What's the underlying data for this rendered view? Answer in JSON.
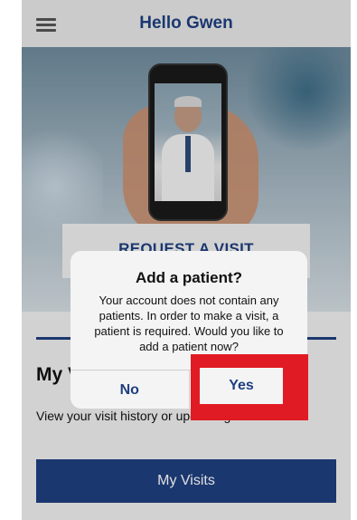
{
  "header": {
    "title": "Hello Gwen",
    "menu_icon": "hamburger-menu-icon"
  },
  "hero": {
    "request_label": "REQUEST A VISIT"
  },
  "section": {
    "title": "My Visits",
    "description": "View your visit history or upcoming visits.",
    "button_label": "My Visits"
  },
  "dialog": {
    "title": "Add a patient?",
    "message": "Your account does not contain any patients. In order to make a visit, a patient is required. Would you like to add a patient now?",
    "no_label": "No",
    "yes_label": "Yes"
  },
  "colors": {
    "brand": "#1f3f80",
    "highlight": "#e11b23"
  }
}
